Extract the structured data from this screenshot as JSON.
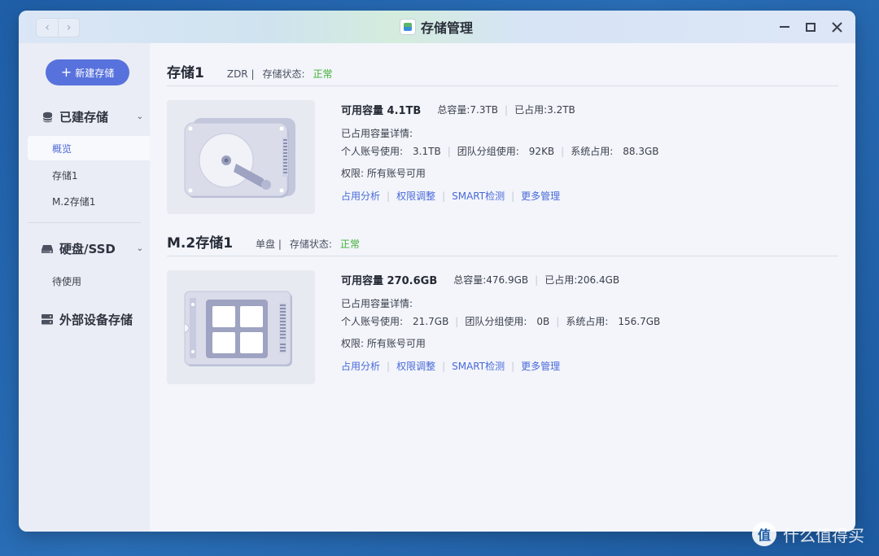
{
  "window": {
    "title": "存储管理",
    "nav_back": "‹",
    "nav_forward": "›"
  },
  "sidebar": {
    "new_button": "新建存储",
    "sections": [
      {
        "label": "已建存储",
        "items": [
          "概览",
          "存储1",
          "M.2存储1"
        ]
      },
      {
        "label": "硬盘/SSD",
        "items": [
          "待使用"
        ]
      },
      {
        "label": "外部设备存储",
        "items": []
      }
    ]
  },
  "pools": [
    {
      "name": "存储1",
      "type_label": "ZDR |",
      "status_label": "存储状态:",
      "status": "正常",
      "capacity_label": "可用容量 4.1TB",
      "total_label": "总容量:",
      "total": "7.3TB",
      "used_label": "已占用:",
      "used": "3.2TB",
      "detail_title": "已占用容量详情:",
      "personal_label": "个人账号使用:",
      "personal": "3.1TB",
      "team_label": "团队分组使用:",
      "team": "92KB",
      "system_label": "系统占用:",
      "system": "88.3GB",
      "permission": "权限: 所有账号可用",
      "links": [
        "占用分析",
        "权限调整",
        "SMART检测",
        "更多管理"
      ],
      "icon": "hdd-icon"
    },
    {
      "name": "M.2存储1",
      "type_label": "单盘 |",
      "status_label": "存储状态:",
      "status": "正常",
      "capacity_label": "可用容量 270.6GB",
      "total_label": "总容量:",
      "total": "476.9GB",
      "used_label": "已占用:",
      "used": "206.4GB",
      "detail_title": "已占用容量详情:",
      "personal_label": "个人账号使用:",
      "personal": "21.7GB",
      "team_label": "团队分组使用:",
      "team": "0B",
      "system_label": "系统占用:",
      "system": "156.7GB",
      "permission": "权限: 所有账号可用",
      "links": [
        "占用分析",
        "权限调整",
        "SMART检测",
        "更多管理"
      ],
      "icon": "m2-ssd-icon"
    }
  ],
  "watermark": {
    "logo": "值",
    "text": "什么值得买"
  },
  "colors": {
    "accent": "#5872dd",
    "link": "#4a6ad8",
    "ok": "#3fae32"
  }
}
